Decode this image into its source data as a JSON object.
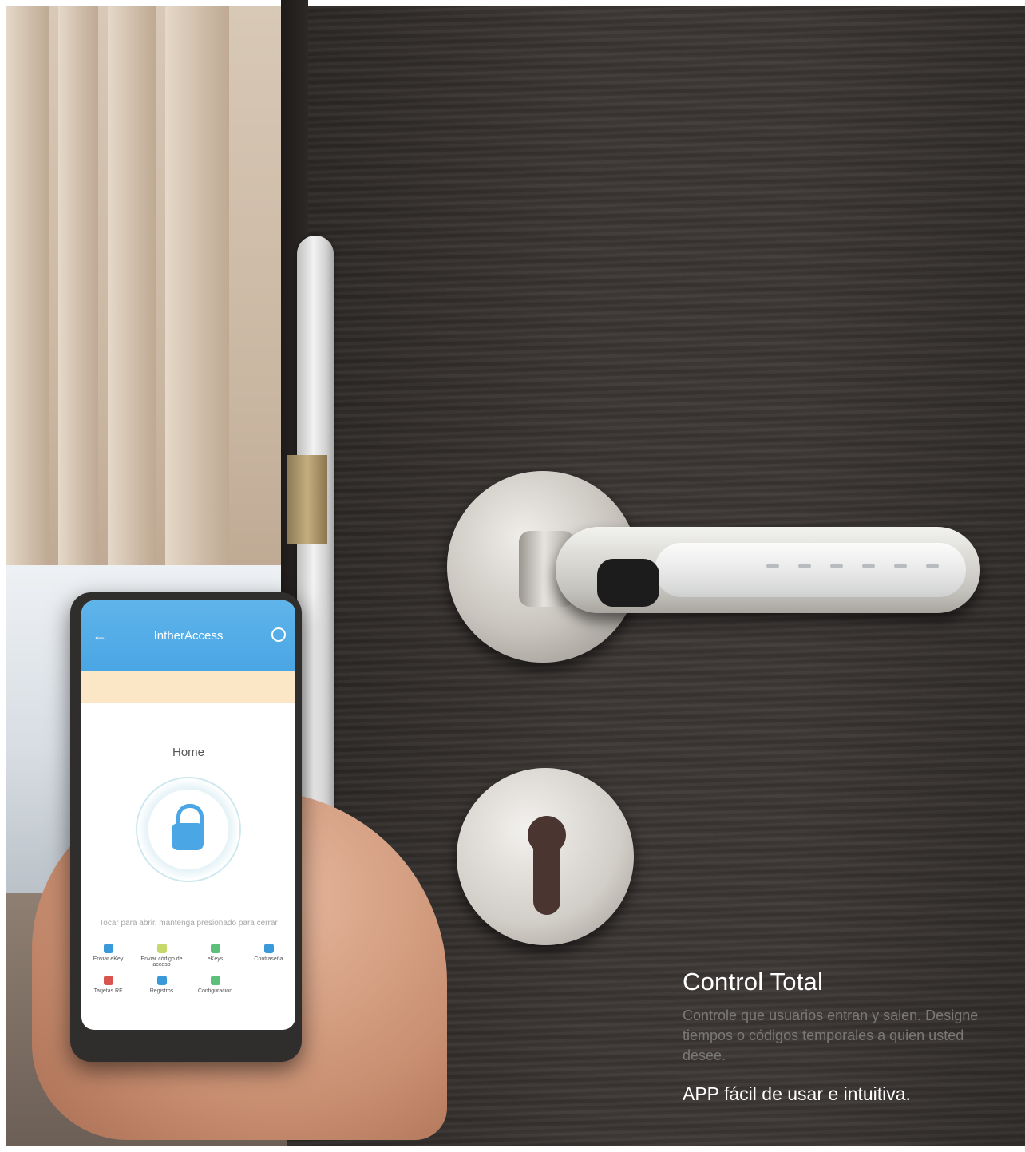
{
  "phone_app": {
    "title": "IntherAccess",
    "home_label": "Home",
    "hint": "Tocar para abrir, mantenga presionado para cerrar",
    "menu": [
      {
        "label": "Enviar eKey",
        "icon": "ekey-icon",
        "color": "#3a9ad9"
      },
      {
        "label": "Enviar código de acceso",
        "icon": "passcode-icon",
        "color": "#c7d86a"
      },
      {
        "label": "eKeys",
        "icon": "keys-icon",
        "color": "#5cbf7a"
      },
      {
        "label": "Contraseña",
        "icon": "password-icon",
        "color": "#3a9ad9"
      },
      {
        "label": "Tarjetas RF",
        "icon": "card-icon",
        "color": "#d9534f"
      },
      {
        "label": "Registros",
        "icon": "records-icon",
        "color": "#3a9ad9"
      },
      {
        "label": "Configuración",
        "icon": "settings-icon",
        "color": "#5cbf7a"
      }
    ]
  },
  "copy": {
    "heading": "Control Total",
    "body": "Controle que usuarios entran y salen. Designe tiempos o códigos temporales a quien usted desee.",
    "tagline": "APP fácil de usar e intuitiva."
  }
}
